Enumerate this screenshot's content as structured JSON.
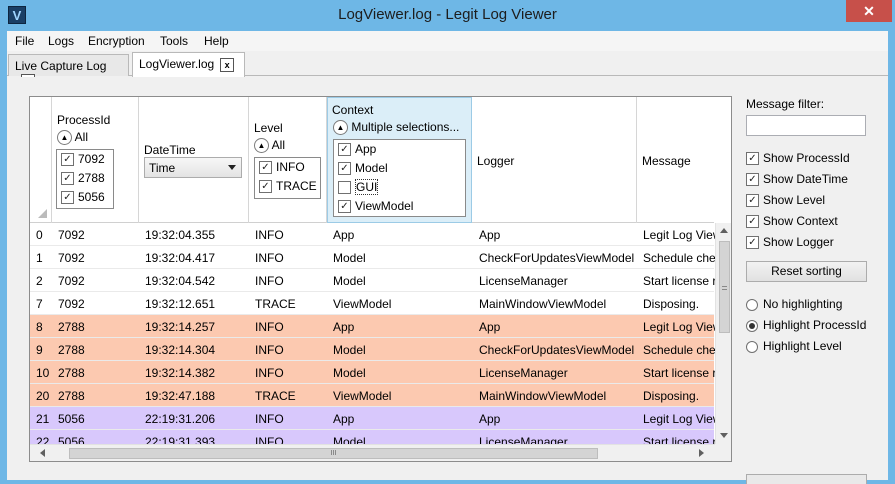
{
  "window": {
    "title": "LogViewer.log - Legit Log Viewer",
    "icon_letter": "V",
    "close_glyph": "✕"
  },
  "menu": [
    {
      "label": "File"
    },
    {
      "label": "Logs"
    },
    {
      "label": "Encryption"
    },
    {
      "label": "Tools"
    },
    {
      "label": "Help"
    }
  ],
  "tabs": [
    {
      "label": "Live Capture Log",
      "close": "x",
      "active": false
    },
    {
      "label": "LogViewer.log",
      "close": "x",
      "active": true
    }
  ],
  "grid": {
    "columns": {
      "processid": {
        "title": "ProcessId",
        "filter_summary": "All",
        "options": [
          {
            "label": "7092",
            "checked": true
          },
          {
            "label": "2788",
            "checked": true
          },
          {
            "label": "5056",
            "checked": true
          }
        ]
      },
      "datetime": {
        "title": "DateTime",
        "combo_value": "Time"
      },
      "level": {
        "title": "Level",
        "filter_summary": "All",
        "options": [
          {
            "label": "INFO",
            "checked": true
          },
          {
            "label": "TRACE",
            "checked": true
          }
        ]
      },
      "context": {
        "title": "Context",
        "filter_summary": "Multiple selections...",
        "options": [
          {
            "label": "App",
            "checked": true
          },
          {
            "label": "Model",
            "checked": true
          },
          {
            "label": "GUI",
            "checked": false
          },
          {
            "label": "ViewModel",
            "checked": true
          }
        ]
      },
      "logger": {
        "title": "Logger"
      },
      "message": {
        "title": "Message"
      }
    },
    "rows": [
      {
        "idx": "0",
        "pid": "7092",
        "time": "19:32:04.355",
        "level": "INFO",
        "context": "App",
        "logger": "App",
        "message": "Legit Log Viewer",
        "color": "#ffffff"
      },
      {
        "idx": "1",
        "pid": "7092",
        "time": "19:32:04.417",
        "level": "INFO",
        "context": "Model",
        "logger": "CheckForUpdatesViewModel",
        "message": "Schedule che",
        "color": "#ffffff"
      },
      {
        "idx": "2",
        "pid": "7092",
        "time": "19:32:04.542",
        "level": "INFO",
        "context": "Model",
        "logger": "LicenseManager",
        "message": "Start license r",
        "color": "#ffffff"
      },
      {
        "idx": "7",
        "pid": "7092",
        "time": "19:32:12.651",
        "level": "TRACE",
        "context": "ViewModel",
        "logger": "MainWindowViewModel",
        "message": "Disposing.",
        "color": "#ffffff"
      },
      {
        "idx": "8",
        "pid": "2788",
        "time": "19:32:14.257",
        "level": "INFO",
        "context": "App",
        "logger": "App",
        "message": "Legit Log View",
        "color": "#fcc9b0"
      },
      {
        "idx": "9",
        "pid": "2788",
        "time": "19:32:14.304",
        "level": "INFO",
        "context": "Model",
        "logger": "CheckForUpdatesViewModel",
        "message": "Schedule che",
        "color": "#fcc9b0"
      },
      {
        "idx": "10",
        "pid": "2788",
        "time": "19:32:14.382",
        "level": "INFO",
        "context": "Model",
        "logger": "LicenseManager",
        "message": "Start license r",
        "color": "#fcc9b0"
      },
      {
        "idx": "20",
        "pid": "2788",
        "time": "19:32:47.188",
        "level": "TRACE",
        "context": "ViewModel",
        "logger": "MainWindowViewModel",
        "message": "Disposing.",
        "color": "#fcc9b0"
      },
      {
        "idx": "21",
        "pid": "5056",
        "time": "22:19:31.206",
        "level": "INFO",
        "context": "App",
        "logger": "App",
        "message": "Legit Log View",
        "color": "#d8c8fc"
      },
      {
        "idx": "22",
        "pid": "5056",
        "time": "22:19:31.393",
        "level": "INFO",
        "context": "Model",
        "logger": "LicenseManager",
        "message": "Start license r",
        "color": "#d8c8fc"
      }
    ],
    "hscroll_grip": "III"
  },
  "panel": {
    "message_filter_label": "Message filter:",
    "message_filter_value": "",
    "checkboxes": [
      {
        "label": "Show ProcessId",
        "checked": true
      },
      {
        "label": "Show DateTime",
        "checked": true
      },
      {
        "label": "Show Level",
        "checked": true
      },
      {
        "label": "Show Context",
        "checked": true
      },
      {
        "label": "Show Logger",
        "checked": true
      }
    ],
    "reset_button": "Reset sorting",
    "radios": [
      {
        "label": "No highlighting",
        "selected": false
      },
      {
        "label": "Highlight ProcessId",
        "selected": true
      },
      {
        "label": "Highlight Level",
        "selected": false
      }
    ]
  },
  "colors": {
    "titlebar": "#6eb7e6",
    "highlight_2788": "#fcc9b0",
    "highlight_5056": "#d8c8fc",
    "context_header": "#dbeef8",
    "close_button": "#c7504a"
  }
}
